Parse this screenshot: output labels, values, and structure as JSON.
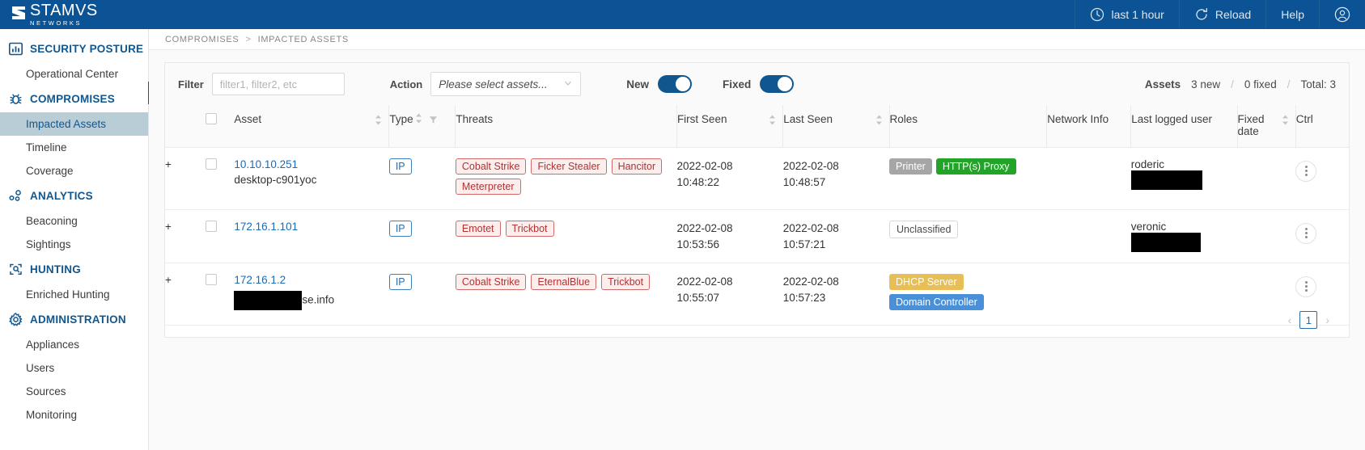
{
  "topbar": {
    "brand_name": "STAMVS",
    "brand_sub": "NETWORKS",
    "time_range": "last 1 hour",
    "reload": "Reload",
    "help": "Help",
    "account_icon": "user-circle-icon",
    "clock_icon": "clock-icon",
    "reload_icon": "refresh-icon"
  },
  "sidebar": {
    "groups": [
      {
        "label": "SECURITY POSTURE",
        "icon": "bar-chart-icon",
        "items": [
          {
            "label": "Operational Center",
            "active": false
          }
        ]
      },
      {
        "label": "COMPROMISES",
        "icon": "bug-icon",
        "items": [
          {
            "label": "Impacted Assets",
            "active": true
          },
          {
            "label": "Timeline",
            "active": false
          },
          {
            "label": "Coverage",
            "active": false
          }
        ]
      },
      {
        "label": "ANALYTICS",
        "icon": "nodes-icon",
        "items": [
          {
            "label": "Beaconing",
            "active": false
          },
          {
            "label": "Sightings",
            "active": false
          }
        ]
      },
      {
        "label": "HUNTING",
        "icon": "hunt-search-icon",
        "items": [
          {
            "label": "Enriched Hunting",
            "active": false
          }
        ]
      },
      {
        "label": "ADMINISTRATION",
        "icon": "gear-icon",
        "items": [
          {
            "label": "Appliances",
            "active": false
          },
          {
            "label": "Users",
            "active": false
          },
          {
            "label": "Sources",
            "active": false
          },
          {
            "label": "Monitoring",
            "active": false
          }
        ]
      }
    ]
  },
  "breadcrumb": {
    "parent": "COMPROMISES",
    "separator": ">",
    "current": "IMPACTED ASSETS"
  },
  "filterbar": {
    "filter_label": "Filter",
    "filter_placeholder": "filter1, filter2, etc",
    "filter_value": "",
    "action_label": "Action",
    "action_value": "Please select assets...",
    "new_label": "New",
    "new_on": true,
    "fixed_label": "Fixed",
    "fixed_on": true,
    "assets_label": "Assets",
    "assets_new": "3 new",
    "assets_fixed": "0 fixed",
    "assets_total": "Total: 3",
    "slash": "/"
  },
  "table": {
    "columns": [
      {
        "label": "",
        "sortable": false
      },
      {
        "label": "",
        "sortable": false
      },
      {
        "label": "Asset",
        "sortable": true
      },
      {
        "label": "Type",
        "sortable": true,
        "filterable": true
      },
      {
        "label": "Threats",
        "sortable": false
      },
      {
        "label": "First Seen",
        "sortable": true
      },
      {
        "label": "Last Seen",
        "sortable": true
      },
      {
        "label": "Roles",
        "sortable": false
      },
      {
        "label": "Network Info",
        "sortable": false
      },
      {
        "label": "Last logged user",
        "sortable": false
      },
      {
        "label": "Fixed date",
        "sortable": true
      },
      {
        "label": "Ctrl",
        "sortable": false
      }
    ],
    "rows": [
      {
        "expand": "+",
        "asset_ip": "10.10.10.251",
        "asset_name": "desktop-c901yoc",
        "asset_name_redacted": false,
        "type": "IP",
        "threats": [
          "Cobalt Strike",
          "Ficker Stealer",
          "Hancitor",
          "Meterpreter"
        ],
        "first_seen_date": "2022-02-08",
        "first_seen_time": "10:48:22",
        "last_seen_date": "2022-02-08",
        "last_seen_time": "10:48:57",
        "roles": [
          {
            "label": "Printer",
            "color": "#a6a6a6",
            "style": "solid"
          },
          {
            "label": "HTTP(s) Proxy",
            "color": "#22a428",
            "style": "solid"
          }
        ],
        "network_info": "",
        "last_logged_user": "roderic",
        "last_logged_user_redacted": true,
        "fixed_date": ""
      },
      {
        "expand": "+",
        "asset_ip": "172.16.1.101",
        "asset_name": "",
        "asset_name_redacted": false,
        "type": "IP",
        "threats": [
          "Emotet",
          "Trickbot"
        ],
        "first_seen_date": "2022-02-08",
        "first_seen_time": "10:53:56",
        "last_seen_date": "2022-02-08",
        "last_seen_time": "10:57:21",
        "roles": [
          {
            "label": "Unclassified",
            "color": "#ffffff",
            "style": "outline"
          }
        ],
        "network_info": "",
        "last_logged_user": "veronic",
        "last_logged_user_redacted": true,
        "fixed_date": ""
      },
      {
        "expand": "+",
        "asset_ip": "172.16.1.2",
        "asset_name": "se.info",
        "asset_name_redacted": true,
        "type": "IP",
        "threats": [
          "Cobalt Strike",
          "EternalBlue",
          "Trickbot"
        ],
        "first_seen_date": "2022-02-08",
        "first_seen_time": "10:55:07",
        "last_seen_date": "2022-02-08",
        "last_seen_time": "10:57:23",
        "roles": [
          {
            "label": "DHCP Server",
            "color": "#e8bf56",
            "style": "solid"
          },
          {
            "label": "Domain Controller",
            "color": "#4a90d9",
            "style": "solid"
          }
        ],
        "network_info": "",
        "last_logged_user": "",
        "last_logged_user_redacted": false,
        "fixed_date": ""
      }
    ]
  },
  "pagination": {
    "prev": "‹",
    "next": "›",
    "current_page": "1"
  },
  "colors": {
    "brand_blue": "#0b5394",
    "accent_blue": "#11578f",
    "link_blue": "#1a6bb5",
    "threat_red": "#b03232",
    "active_row_bg": "#b9cdd6"
  }
}
